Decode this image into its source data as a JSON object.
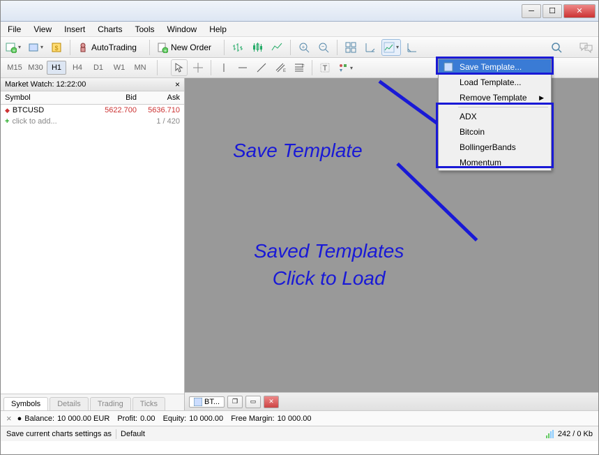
{
  "menubar": [
    "File",
    "View",
    "Insert",
    "Charts",
    "Tools",
    "Window",
    "Help"
  ],
  "toolbar": {
    "autotrading_label": "AutoTrading",
    "neworder_label": "New Order"
  },
  "timeframes": [
    "M15",
    "M30",
    "H1",
    "H4",
    "D1",
    "W1",
    "MN"
  ],
  "active_timeframe": "H1",
  "market_watch": {
    "title": "Market Watch: 12:22:00",
    "headers": {
      "symbol": "Symbol",
      "bid": "Bid",
      "ask": "Ask"
    },
    "rows": [
      {
        "symbol": "BTCUSD",
        "bid": "5622.700",
        "ask": "5636.710",
        "dir": "down"
      }
    ],
    "add_label": "click to add...",
    "add_count": "1 / 420",
    "tabs": [
      "Symbols",
      "Details",
      "Trading",
      "Ticks"
    ]
  },
  "template_menu": {
    "save": "Save Template...",
    "load": "Load Template...",
    "remove": "Remove Template",
    "templates": [
      "ADX",
      "Bitcoin",
      "BollingerBands",
      "Momentum"
    ]
  },
  "annotations": {
    "save": "Save Template",
    "saved": "Saved Templates",
    "click": "Click to Load"
  },
  "mdi": {
    "tab_label": "BT..."
  },
  "balance": {
    "balance_label": "Balance:",
    "balance_value": "10 000.00 EUR",
    "profit_label": "Profit:",
    "profit_value": "0.00",
    "equity_label": "Equity:",
    "equity_value": "10 000.00",
    "margin_label": "Free Margin:",
    "margin_value": "10 000.00"
  },
  "status": {
    "hint": "Save current charts settings as",
    "profile": "Default",
    "net": "242 / 0 Kb"
  }
}
